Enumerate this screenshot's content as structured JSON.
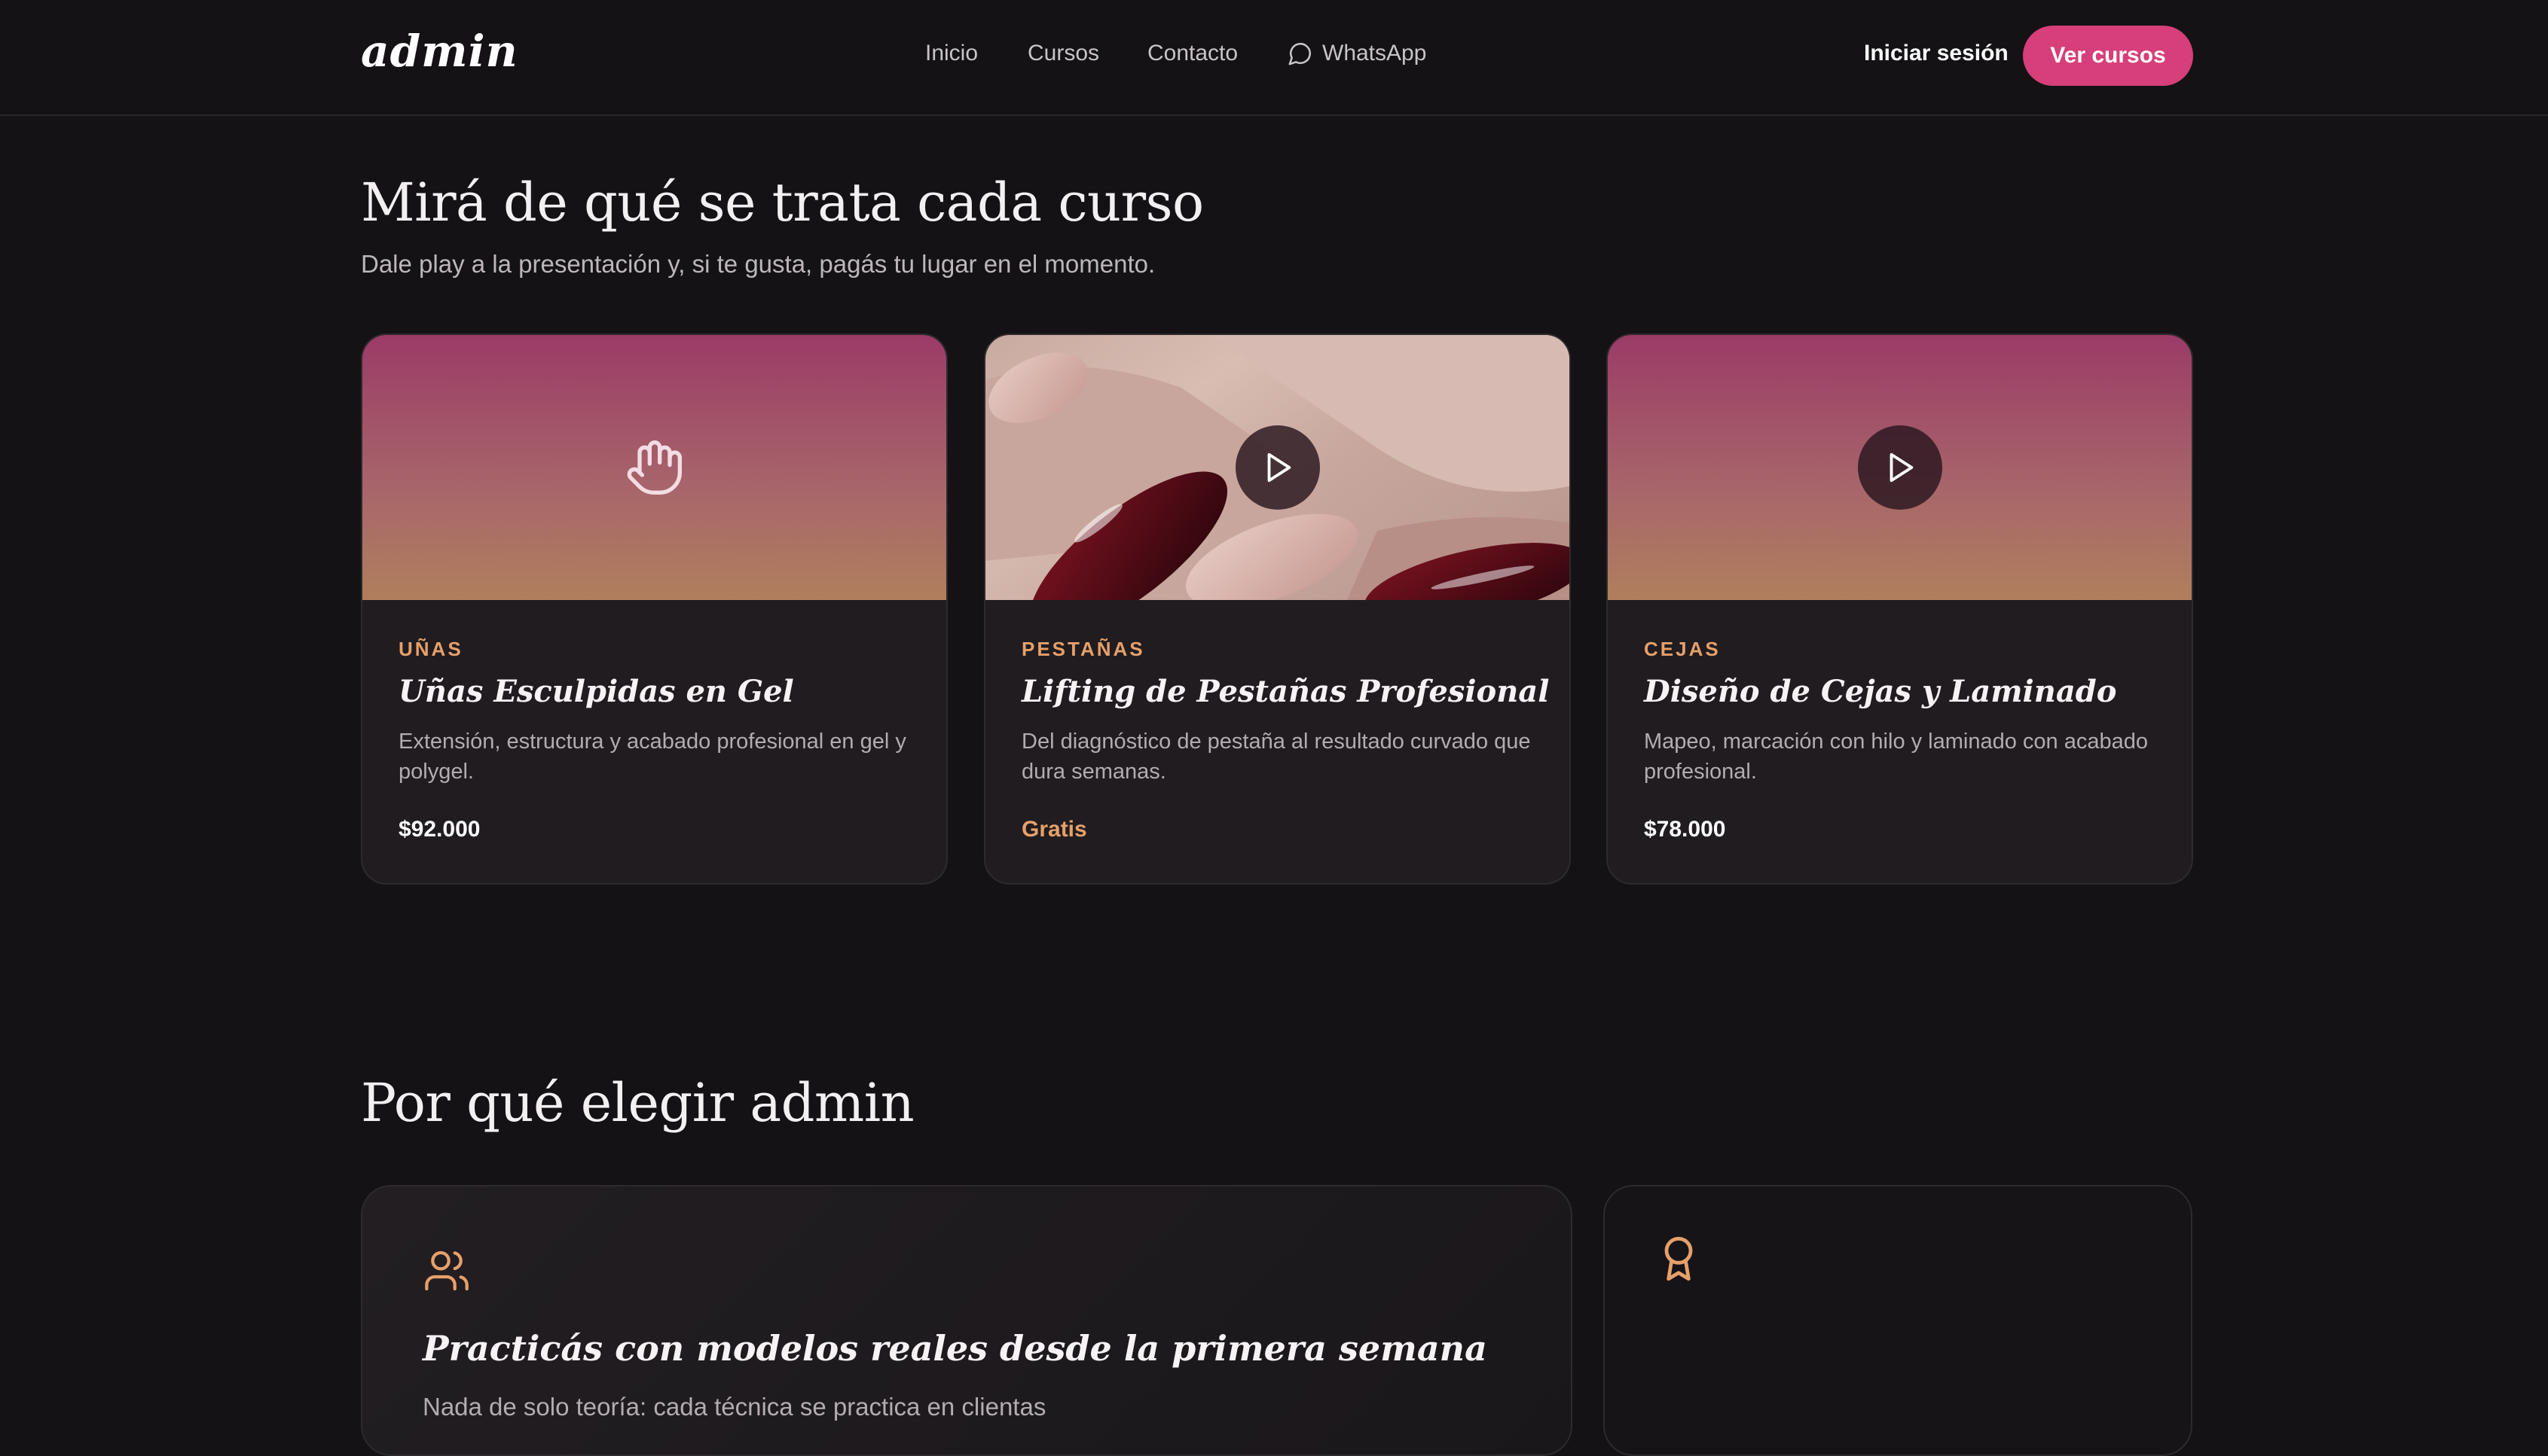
{
  "header": {
    "logo": "admin",
    "nav": {
      "inicio": "Inicio",
      "cursos": "Cursos",
      "contacto": "Contacto",
      "whatsapp": "WhatsApp"
    },
    "login": "Iniciar sesión",
    "cta": "Ver cursos"
  },
  "courses_section": {
    "title": "Mirá de qué se trata cada curso",
    "subtitle": "Dale play a la presentación y, si te gusta, pagás tu lugar en el momento.",
    "cards": [
      {
        "category": "UÑAS",
        "title": "Uñas Esculpidas en Gel",
        "description": "Extensión, estructura y acabado profesional en gel y polygel.",
        "price": "$92.000",
        "media_icon": "hand-icon"
      },
      {
        "category": "PESTAÑAS",
        "title": "Lifting de Pestañas Profesional",
        "description": "Del diagnóstico de pestaña al resultado curvado que dura semanas.",
        "price": "Gratis",
        "media_icon": "play-icon"
      },
      {
        "category": "CEJAS",
        "title": "Diseño de Cejas y Laminado",
        "description": "Mapeo, marcación con hilo y laminado con acabado profesional.",
        "price": "$78.000",
        "media_icon": "play-icon"
      }
    ]
  },
  "why_section": {
    "title": "Por qué elegir admin",
    "features": [
      {
        "icon": "users-icon",
        "title": "Practicás con modelos reales desde la primera semana",
        "description": "Nada de solo teoría: cada técnica se practica en clientas"
      },
      {
        "icon": "award-icon"
      }
    ]
  },
  "colors": {
    "background": "#141215",
    "accent": "#d63f7a",
    "category": "#e6a06a"
  }
}
